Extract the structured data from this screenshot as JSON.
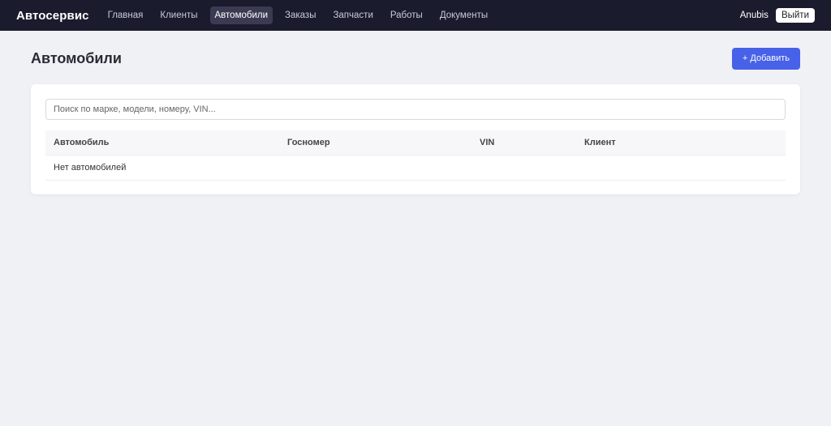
{
  "header": {
    "brand": "Автосервис",
    "nav": [
      "Главная",
      "Клиенты",
      "Автомобили",
      "Заказы",
      "Запчасти",
      "Работы",
      "Документы"
    ],
    "active_nav": "Автомобили",
    "username": "Anubis",
    "logout_label": "Выйти"
  },
  "page": {
    "title": "Автомобили",
    "add_label": "+ Добавить"
  },
  "search": {
    "placeholder": "Поиск по марке, модели, номеру, VIN...",
    "value": ""
  },
  "table": {
    "columns": [
      "Автомобиль",
      "Госномер",
      "VIN",
      "Клиент"
    ],
    "rows": [],
    "empty_text": "Нет автомобилей"
  },
  "colors": {
    "topbar": "#1b1b2e",
    "accent": "#4761e8",
    "background": "#f0f1f5"
  }
}
